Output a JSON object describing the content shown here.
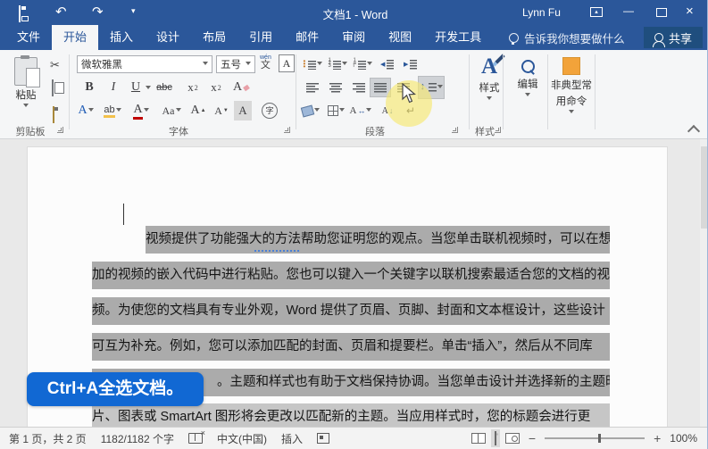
{
  "window": {
    "title": "文档1 - Word",
    "user": "Lynn Fu"
  },
  "tabs": [
    "文件",
    "开始",
    "插入",
    "设计",
    "布局",
    "引用",
    "邮件",
    "审阅",
    "视图",
    "开发工具"
  ],
  "tell_me": "告诉我你想要做什么",
  "share_label": "共享",
  "icons": {
    "undo": "↶",
    "redo": "↷",
    "qat_caret": "▾",
    "rdo_arrow": "▴",
    "minimize": "—",
    "close": "×",
    "cut": "✂",
    "line_spacing_arrow": "↕",
    "zh_arrow": "↔",
    "sort_arrow": "↓",
    "pilcrow": "↵",
    "grow_arrow": "▲",
    "shrink_arrow": "▼",
    "zoom_out": "−",
    "zoom_in": "+"
  },
  "ribbon": {
    "paste_label": "粘贴",
    "clipboard_group": "剪贴板",
    "font_name": "微软雅黑",
    "font_size": "五号",
    "font_group": "字体",
    "paragraph_group": "段落",
    "styles_button": "样式",
    "styles_group": "样式",
    "editing_button": "编辑",
    "custom_button_line1": "非典型常",
    "custom_button_line2": "用命令",
    "phonetic_top": "wén",
    "phonetic_char": "文",
    "char_border": "A",
    "bold": "B",
    "italic": "I",
    "underline": "U",
    "strike": "abc",
    "sub_base": "x",
    "sub_mark": "2",
    "sup_base": "x",
    "sup_mark": "2",
    "clear_fmt": "A",
    "text_effect": "A",
    "highlight": "ab",
    "font_color": "A",
    "change_case": "Aa",
    "grow": "A",
    "shrink": "A",
    "shade": "A",
    "enclose": "字",
    "zh_layout": "A",
    "sort_a": "A"
  },
  "document": {
    "callout": "Ctrl+A全选文档。",
    "lines": [
      "视频提供了功能强大的方法帮助您证明您的观点。当您单击联机视频时，可以在想要添",
      "加的视频的嵌入代码中进行粘贴。您也可以键入一个关键字以联机搜索最适合您的文档的视",
      "频。为使您的文档具有专业外观，Word 提供了页眉、页脚、封面和文本框设计，这些设计",
      "可互为补充。例如，您可以添加匹配的封面、页眉和提要栏。单击“插入”，然后从不同库",
      "。主题和样式也有助于文档保持协调。当您单击设计并选择新的主题时，图",
      "片、图表或 SmartArt 图形将会更改以匹配新的主题。当应用样式时，您的标题会进行更"
    ]
  },
  "status": {
    "page": "第 1 页，共 2 页",
    "words": "1182/1182 个字",
    "language": "中文(中国)",
    "insert_mode": "插入",
    "zoom": "100%"
  },
  "colors": {
    "accent": "#2b579a",
    "callout": "#1168d3",
    "selection": "#ababab"
  }
}
